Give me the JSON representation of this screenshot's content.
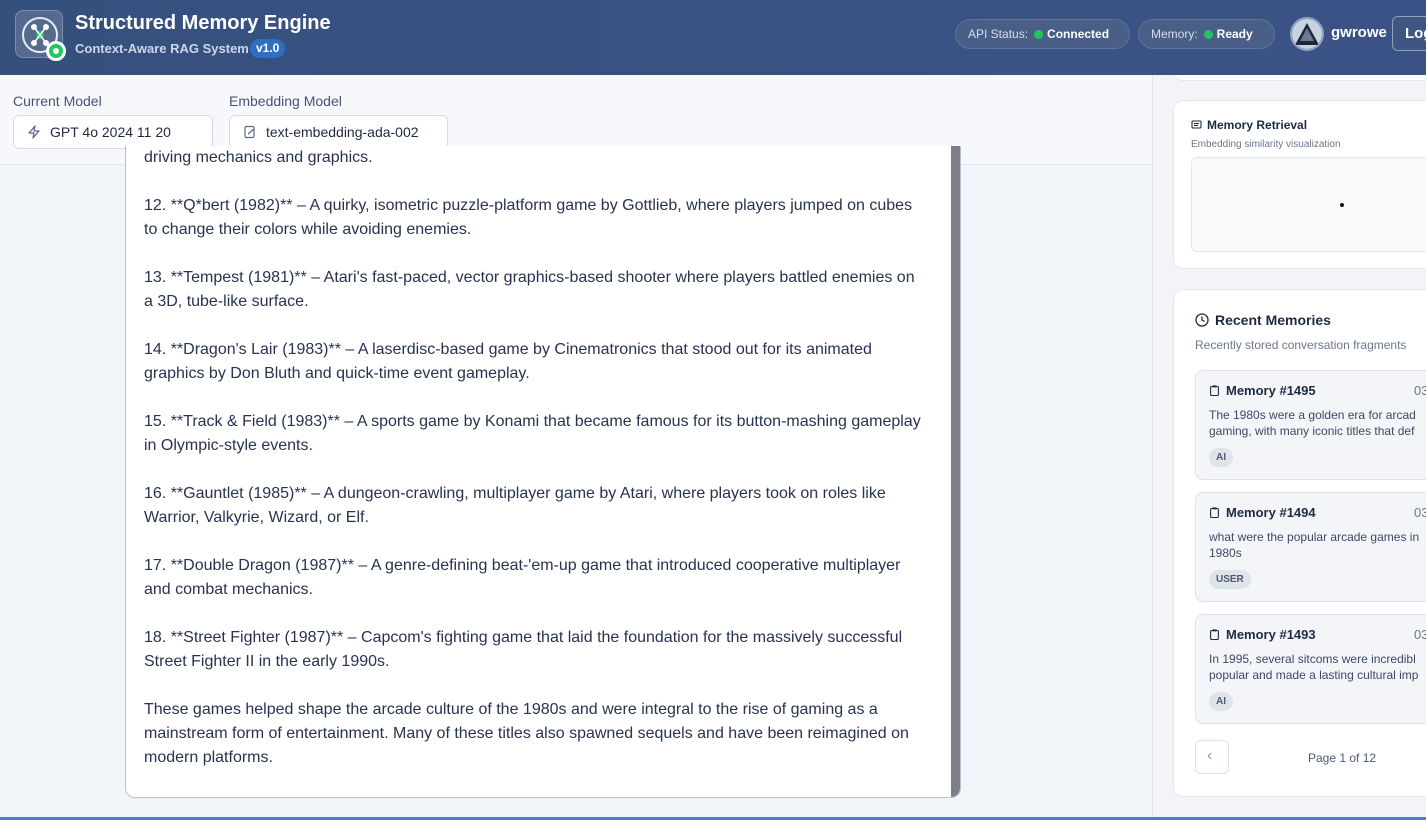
{
  "header": {
    "title": "Structured Memory Engine",
    "subtitle": "Context-Aware RAG System",
    "version": "v1.0",
    "api_status_label": "API Status:",
    "api_status_value": "Connected",
    "memory_label": "Memory:",
    "memory_value": "Ready",
    "username": "gwrowe",
    "logout_label": "Log",
    "status_color": "#22c55e"
  },
  "models": {
    "current_label": "Current Model",
    "current_value": "GPT 4o 2024 11 20",
    "embedding_label": "Embedding Model",
    "embedding_value": "text-embedding-ada-002"
  },
  "message": {
    "top_line": "driving mechanics and graphics.",
    "items": [
      "12. **Q*bert (1982)** – A quirky, isometric puzzle-platform game by Gottlieb, where players jumped on cubes to change their colors while avoiding enemies.",
      "13. **Tempest (1981)** – Atari's fast-paced, vector graphics-based shooter where players battled enemies on a 3D, tube-like surface.",
      "14. **Dragon's Lair (1983)** – A laserdisc-based game by Cinematronics that stood out for its animated graphics by Don Bluth and quick-time event gameplay.",
      "15. **Track & Field (1983)** – A sports game by Konami that became famous for its button-mashing gameplay in Olympic-style events.",
      "16. **Gauntlet (1985)** – A dungeon-crawling, multiplayer game by Atari, where players took on roles like Warrior, Valkyrie, Wizard, or Elf.",
      "17. **Double Dragon (1987)** – A genre-defining beat-'em-up game that introduced cooperative multiplayer and combat mechanics.",
      "18. **Street Fighter (1987)** – Capcom's fighting game that laid the foundation for the massively successful Street Fighter II in the early 1990s."
    ],
    "closing": "These games helped shape the arcade culture of the 1980s and were integral to the rise of gaming as a mainstream form of entertainment. Many of these titles also spawned sequels and have been reimagined on modern platforms."
  },
  "retrieval": {
    "title": "Memory Retrieval",
    "subtitle": "Embedding similarity visualization"
  },
  "recent": {
    "title": "Recent Memories",
    "subtitle": "Recently stored conversation fragments",
    "memories": [
      {
        "title": "Memory #1495",
        "date": "03",
        "text": "The 1980s were a golden era for arcad gaming, with many iconic titles that def",
        "tag": "AI"
      },
      {
        "title": "Memory #1494",
        "date": "03",
        "text": "what were the popular arcade games in 1980s",
        "tag": "USER"
      },
      {
        "title": "Memory #1493",
        "date": "03/",
        "text": "In 1995, several sitcoms were incredibl popular and made a lasting cultural imp",
        "tag": "AI"
      }
    ],
    "pager": "Page 1 of 12"
  }
}
